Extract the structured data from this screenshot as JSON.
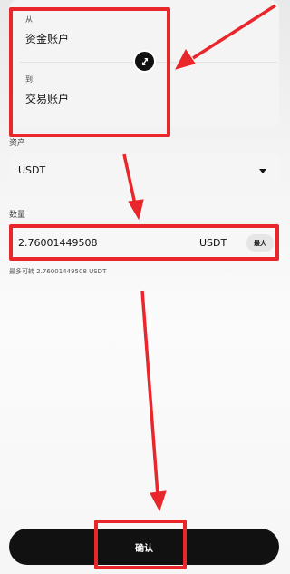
{
  "transfer": {
    "from_label": "从",
    "from_account": "资金账户",
    "to_label": "到",
    "to_account": "交易账户"
  },
  "asset": {
    "label": "资产",
    "selected": "USDT"
  },
  "amount": {
    "label": "数量",
    "value": "2.76001449508",
    "unit": "USDT",
    "max_label": "最大",
    "available_text": "最多可转 2.76001449508 USDT"
  },
  "confirm_label": "确认",
  "annotation_color": "#e8262b"
}
